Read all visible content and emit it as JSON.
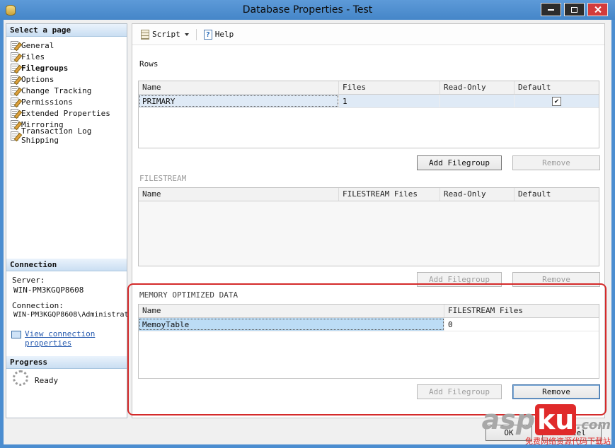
{
  "window": {
    "title": "Database Properties - Test"
  },
  "toolbar": {
    "script_label": "Script",
    "help_label": "Help"
  },
  "glyphs": {
    "check": "✔",
    "help": "?"
  },
  "sidebar": {
    "select_page_header": "Select a page",
    "items": [
      {
        "label": "General"
      },
      {
        "label": "Files"
      },
      {
        "label": "Filegroups"
      },
      {
        "label": "Options"
      },
      {
        "label": "Change Tracking"
      },
      {
        "label": "Permissions"
      },
      {
        "label": "Extended Properties"
      },
      {
        "label": "Mirroring"
      },
      {
        "label": "Transaction Log Shipping"
      }
    ],
    "connection_header": "Connection",
    "server_label": "Server:",
    "server_value": "WIN-PM3KGQP8608",
    "connection_label": "Connection:",
    "connection_value": "WIN-PM3KGQP8608\\Administrat",
    "view_connection_link": "View connection properties",
    "progress_header": "Progress",
    "progress_status": "Ready"
  },
  "rows_section": {
    "title": "Rows",
    "columns": [
      "Name",
      "Files",
      "Read-Only",
      "Default"
    ],
    "row": {
      "name": "PRIMARY",
      "files": "1",
      "read_only": ""
    },
    "add_button": "Add Filegroup",
    "remove_button": "Remove"
  },
  "filestream_section": {
    "title": "FILESTREAM",
    "columns": [
      "Name",
      "FILESTREAM Files",
      "Read-Only",
      "Default"
    ],
    "add_button": "Add Filegroup",
    "remove_button": "Remove"
  },
  "memory_section": {
    "title": "MEMORY OPTIMIZED DATA",
    "columns": [
      "Name",
      "FILESTREAM Files"
    ],
    "row": {
      "name": "MemoyTable",
      "files": "0"
    },
    "add_button": "Add Filegroup",
    "remove_button": "Remove"
  },
  "footer": {
    "ok_label": "OK",
    "cancel_label": "Cancel"
  },
  "watermark": {
    "brand_prefix": "asp",
    "brand_highlight": "ku",
    "brand_suffix": ".com",
    "subtitle": "免费网络资源代码下载站"
  }
}
